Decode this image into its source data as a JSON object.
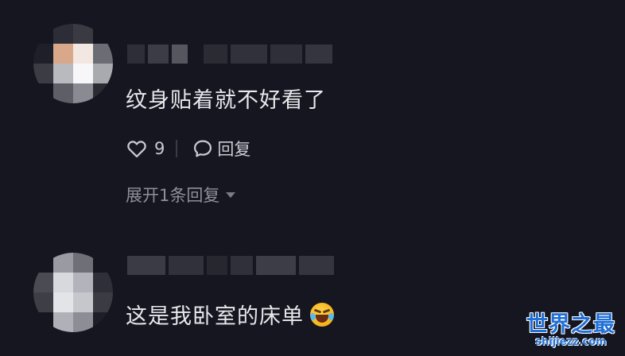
{
  "comments": [
    {
      "text": "纹身贴着就不好看了",
      "likes": "9",
      "reply_label": "回复",
      "expand_label": "展开1条回复"
    },
    {
      "text": "这是我卧室的床单",
      "emoji": "rolling-on-floor-laughing-emoji"
    }
  ],
  "watermark": {
    "title": "世界之最",
    "url": "shijiezz.com"
  },
  "colors": {
    "background": "#151620",
    "text": "#e8e8ec",
    "muted": "#8d8f99",
    "watermark": "#1f6fd6"
  }
}
